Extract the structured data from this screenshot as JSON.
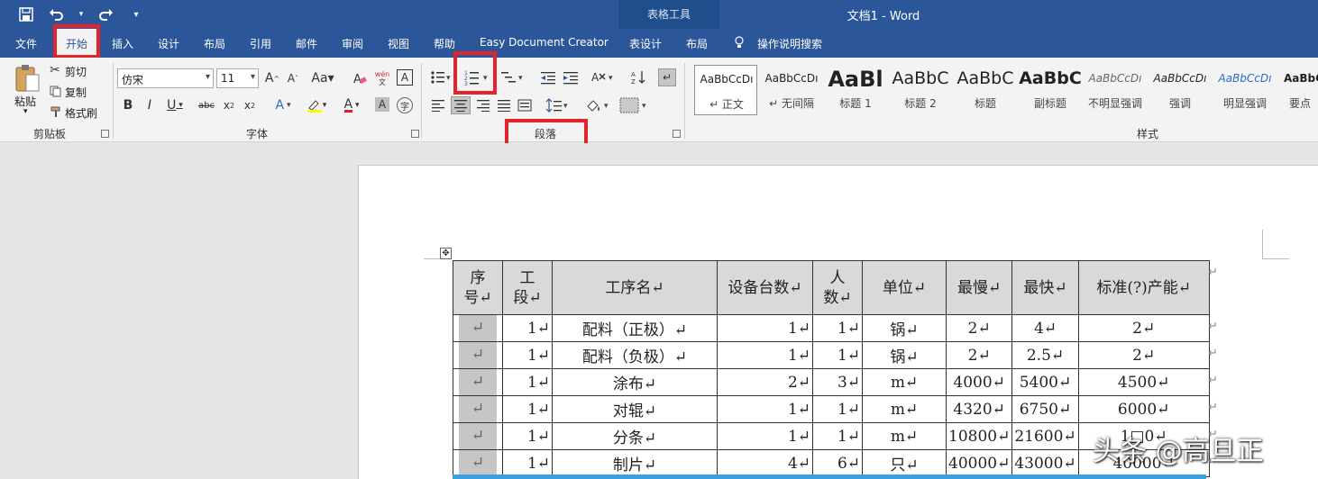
{
  "titlebar": {
    "context_tab_group": "表格工具",
    "document_title": "文档1 - Word",
    "qat": {
      "save": "save",
      "undo": "undo",
      "redo": "redo",
      "customize": "customize"
    }
  },
  "tabs": [
    "文件",
    "开始",
    "插入",
    "设计",
    "布局",
    "引用",
    "邮件",
    "审阅",
    "视图",
    "帮助",
    "Easy Document Creator",
    "表设计",
    "布局"
  ],
  "tell_me": "操作说明搜索",
  "clipboard": {
    "paste": "粘贴",
    "cut": "剪切",
    "copy": "复制",
    "format_painter": "格式刷",
    "group_label": "剪贴板"
  },
  "font": {
    "name": "仿宋",
    "size": "11",
    "group_label": "字体"
  },
  "paragraph": {
    "group_label": "段落"
  },
  "styles": {
    "group_label": "样式",
    "items": [
      {
        "sample": "AaBbCcDı",
        "name": "↵ 正文"
      },
      {
        "sample": "AaBbCcDı",
        "name": "↵ 无间隔"
      },
      {
        "sample": "AaBl",
        "name": "标题 1"
      },
      {
        "sample": "AaBbC",
        "name": "标题 2"
      },
      {
        "sample": "AaBbC",
        "name": "标题"
      },
      {
        "sample": "AaBbC",
        "name": "副标题"
      },
      {
        "sample": "AaBbCcDı",
        "name": "不明显强调"
      },
      {
        "sample": "AaBbCcDı",
        "name": "强调"
      },
      {
        "sample": "AaBbCcDı",
        "name": "明显强调"
      },
      {
        "sample": "AaBbC",
        "name": "要点"
      }
    ]
  },
  "table": {
    "headers": [
      [
        "序",
        "号↵"
      ],
      [
        "工",
        "段↵"
      ],
      [
        "工序名↵"
      ],
      [
        "设备台数↵"
      ],
      [
        "人",
        "数↵"
      ],
      [
        "单位↵"
      ],
      [
        "最慢↵"
      ],
      [
        "最快↵"
      ],
      [
        "标准(?)产能↵"
      ]
    ],
    "rows": [
      [
        "↵",
        "1↵",
        "配料（正极）↵",
        "1↵",
        "1↵",
        "锅↵",
        "2↵",
        "4↵",
        "2↵"
      ],
      [
        "↵",
        "1↵",
        "配料（负极）↵",
        "1↵",
        "1↵",
        "锅↵",
        "2↵",
        "2.5↵",
        "2↵"
      ],
      [
        "↵",
        "1↵",
        "涂布↵",
        "2↵",
        "3↵",
        "m↵",
        "4000↵",
        "5400↵",
        "4500↵"
      ],
      [
        "↵",
        "1↵",
        "对辊↵",
        "1↵",
        "1↵",
        "m↵",
        "4320↵",
        "6750↵",
        "6000↵"
      ],
      [
        "↵",
        "1↵",
        "分条↵",
        "1↵",
        "1↵",
        "m↵",
        "10800↵",
        "21600↵",
        "1□0↵"
      ],
      [
        "↵",
        "1↵",
        "制片↵",
        "4↵",
        "6↵",
        "只↵",
        "40000↵",
        "43000↵",
        "40000↵"
      ]
    ],
    "row_end_mark": "↵"
  },
  "watermark": "头条 @高旦正"
}
